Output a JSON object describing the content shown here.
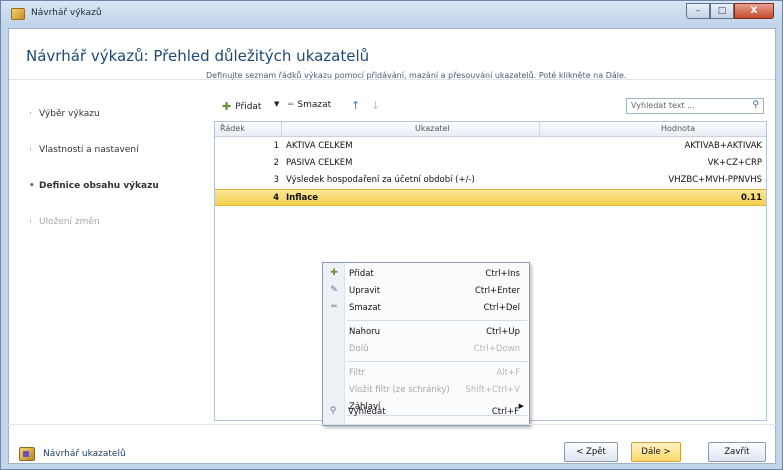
{
  "window": {
    "title": "Návrhář výkazů",
    "controls": {
      "minimize": "–",
      "maximize": "□",
      "close": "X"
    }
  },
  "page": {
    "title": "Návrhář výkazů: Přehled důležitých ukazatelů",
    "instructions": "Definujte seznam řádků výkazu pomocí přidávání, mazání a přesouvání ukazatelů. Poté klikněte na Dále."
  },
  "steps": [
    {
      "label": "Výběr výkazu",
      "state": "normal"
    },
    {
      "label": "Vlastnosti a nastavení",
      "state": "normal"
    },
    {
      "label": "Definice obsahu výkazu",
      "state": "active"
    },
    {
      "label": "Uložení změn",
      "state": "disabled"
    }
  ],
  "toolbar": {
    "add_label": "Přidat",
    "add_dropdown": "▼",
    "delete_label": "Smazat",
    "move_up": "↑",
    "move_down": "↓"
  },
  "search": {
    "placeholder": "Vyhledat text ...",
    "icon": "search-icon"
  },
  "grid": {
    "columns": [
      "Řádek",
      "Ukazatel",
      "Hodnota"
    ],
    "rows": [
      {
        "num": "1",
        "indicator": "AKTIVA CELKEM",
        "value": "AKTIVAB+AKTIVAK"
      },
      {
        "num": "2",
        "indicator": "PASIVA CELKEM",
        "value": "VK+CZ+CRP"
      },
      {
        "num": "3",
        "indicator": "Výsledek hospodaření za účetní období (+/-)",
        "value": "VHZBC+MVH-PPNVHS"
      },
      {
        "num": "4",
        "indicator": "Inflace",
        "value": "0.11"
      }
    ]
  },
  "context_menu": {
    "items": [
      {
        "label": "Přidat",
        "shortcut": "Ctrl+Ins",
        "icon": "add-icon",
        "enabled": true
      },
      {
        "label": "Upravit",
        "shortcut": "Ctrl+Enter",
        "icon": "pencil-icon",
        "enabled": true
      },
      {
        "label": "Smazat",
        "shortcut": "Ctrl+Del",
        "icon": "delete-icon",
        "enabled": true
      },
      {
        "label": "Nahoru",
        "shortcut": "Ctrl+Up",
        "enabled": true
      },
      {
        "label": "Dolů",
        "shortcut": "Ctrl+Down",
        "enabled": false
      },
      {
        "label": "Filtr",
        "shortcut": "Alt+F",
        "enabled": false
      },
      {
        "label": "Vložit filtr (ze schránky)",
        "shortcut": "Shift+Ctrl+V",
        "enabled": false
      },
      {
        "label": "Záhlaví",
        "shortcut": "",
        "submenu": true,
        "enabled": true
      },
      {
        "label": "Vyhledat",
        "shortcut": "Ctrl+F",
        "icon": "search-icon",
        "enabled": true
      }
    ]
  },
  "footer": {
    "designer_link": "Návrhář ukazatelů",
    "back_label": "< Zpět",
    "next_label": "Dále >",
    "close_label": "Zavřít"
  },
  "colors": {
    "selection": "#f5cf4d",
    "title": "#1d4a78",
    "accent": "#2f64a8"
  }
}
